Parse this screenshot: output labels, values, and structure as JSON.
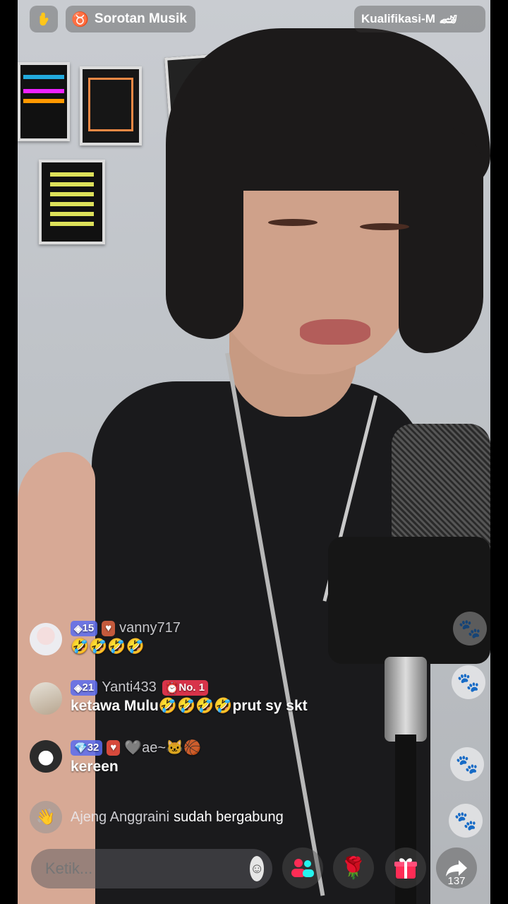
{
  "header": {
    "hand_icon": "hand-icon",
    "spotlight_label": "Sorotan Musik",
    "qualification_label": "Kualifikasi-M"
  },
  "chat": [
    {
      "level": "15",
      "username": "vanny717",
      "message": "🤣🤣🤣🤣"
    },
    {
      "level": "21",
      "username": "Yanti433",
      "rank": "No. 1",
      "message": "ketawa Mulu🤣🤣🤣🤣prut sy skt"
    },
    {
      "level": "32",
      "username": "🩶ae~🐱🏀",
      "message": "kereen"
    }
  ],
  "join_notice": {
    "name": "Ajeng Anggraini",
    "text": "sudah bergabung"
  },
  "bottom_bar": {
    "input_placeholder": "Ketik...",
    "share_count": "137"
  },
  "colors": {
    "accent_pink": "#fe2c55",
    "rank_red": "#d8334a",
    "level_blue": "#5b6cf0"
  }
}
